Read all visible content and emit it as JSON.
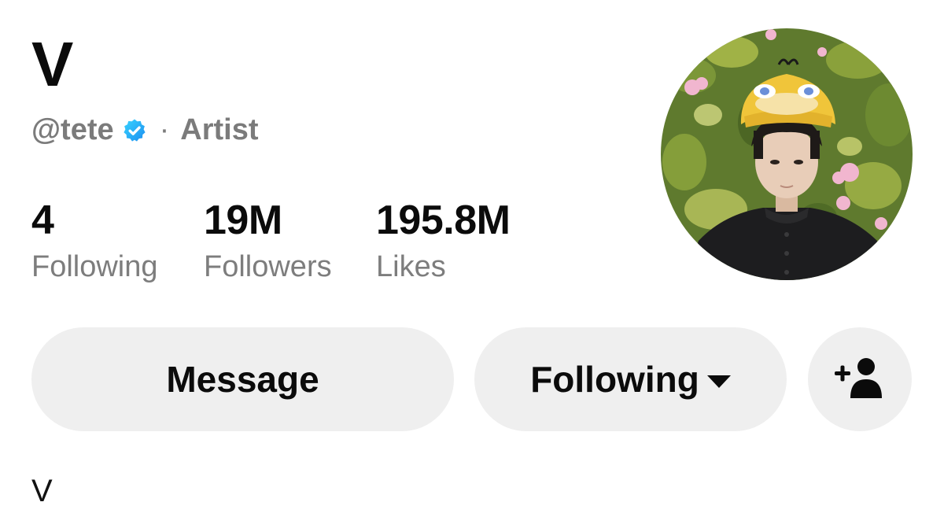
{
  "profile": {
    "display_name": "V",
    "handle": "@tete",
    "separator": "·",
    "category": "Artist",
    "verified": true,
    "bio": "V"
  },
  "stats": {
    "following": {
      "value": "4",
      "label": "Following"
    },
    "followers": {
      "value": "19M",
      "label": "Followers"
    },
    "likes": {
      "value": "195.8M",
      "label": "Likes"
    }
  },
  "actions": {
    "message_label": "Message",
    "following_label": "Following",
    "following_icon": "caret-down-icon",
    "add_friend_icon": "add-user-icon"
  },
  "colors": {
    "text_primary": "#0b0b0b",
    "text_secondary": "#7b7b7b",
    "button_bg": "#efefef",
    "verified_badge": "#20c4f4"
  }
}
